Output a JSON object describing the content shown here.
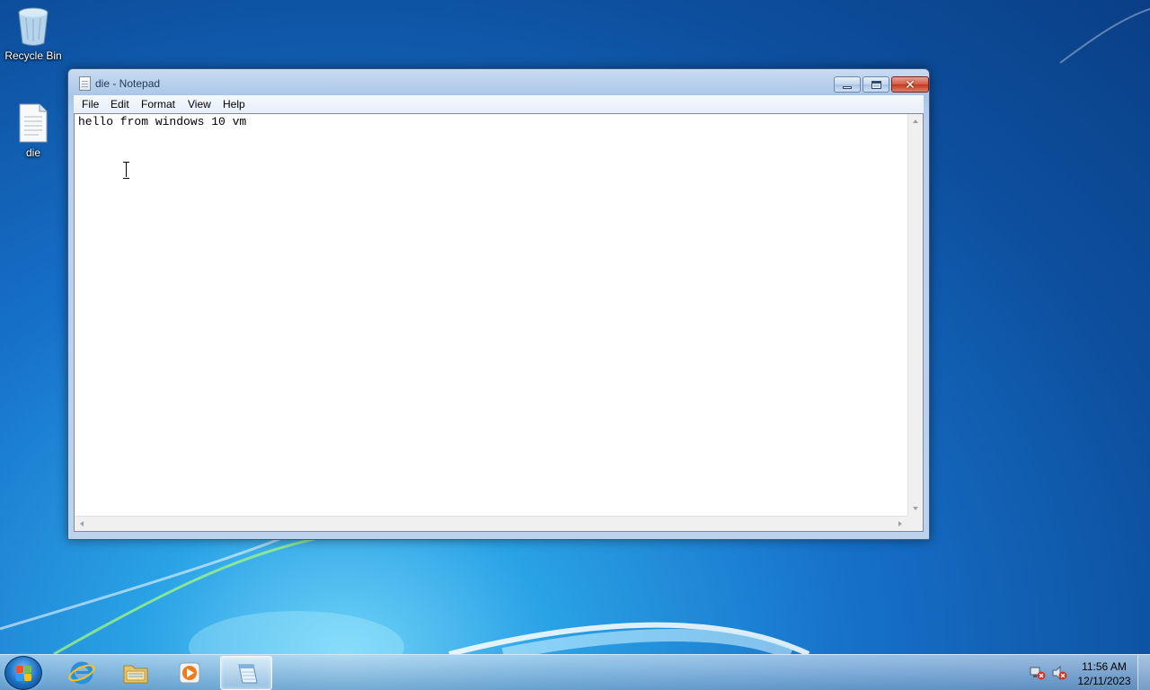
{
  "desktop": {
    "icons": [
      {
        "label": "Recycle Bin",
        "icon": "recycle-bin-icon"
      },
      {
        "label": "die",
        "icon": "text-file-icon"
      }
    ]
  },
  "window": {
    "title": "die - Notepad",
    "app_icon": "notepad-icon",
    "controls": {
      "minimize": "minimize-icon",
      "maximize": "maximize-icon",
      "close": "close-icon",
      "close_glyph": "✕"
    },
    "menu": [
      "File",
      "Edit",
      "Format",
      "View",
      "Help"
    ],
    "content": "hello from windows 10 vm"
  },
  "taskbar": {
    "start_icon": "windows-logo-icon",
    "pinned": [
      {
        "name": "Internet Explorer",
        "icon": "internet-explorer-icon"
      },
      {
        "name": "Windows Explorer",
        "icon": "folder-icon"
      },
      {
        "name": "Windows Media Player",
        "icon": "media-player-icon"
      },
      {
        "name": "Notepad",
        "icon": "notepad-icon",
        "active": true
      }
    ],
    "tray": {
      "network_icon": "network-error-icon",
      "volume_icon": "volume-muted-icon"
    },
    "clock": {
      "time": "11:56 AM",
      "date": "12/11/2023"
    }
  },
  "colors": {
    "title_text": "#1e395b",
    "close_button": "#c4371e",
    "accent": "#1670c8"
  }
}
